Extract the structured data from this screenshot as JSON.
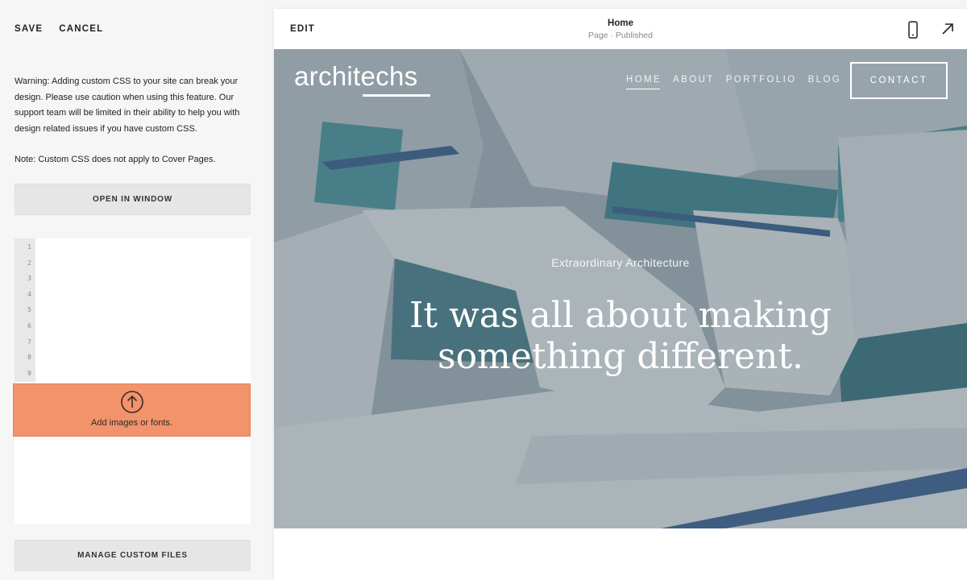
{
  "left_panel": {
    "save_label": "SAVE",
    "cancel_label": "CANCEL",
    "warning_text": "Warning: Adding custom CSS to your site can break your design. Please use caution when using this feature. Our support team will be limited in their ability to help you with design related issues if you have custom CSS.",
    "note_text": "Note: Custom CSS does not apply to Cover Pages.",
    "open_window_label": "OPEN IN WINDOW",
    "line_numbers": [
      "1",
      "2",
      "3",
      "4",
      "5",
      "6",
      "7",
      "8",
      "9"
    ],
    "upload_label": "Add images or fonts.",
    "manage_files_label": "MANAGE CUSTOM FILES",
    "upload_color": "#f2936b"
  },
  "preview": {
    "edit_label": "EDIT",
    "page_title": "Home",
    "page_status": "Page · Published",
    "icons": {
      "mobile": "phone-icon",
      "open": "external-link-icon"
    },
    "site": {
      "logo": "architechs",
      "nav": [
        "HOME",
        "ABOUT",
        "PORTFOLIO",
        "BLOG"
      ],
      "active_nav": "HOME",
      "contact_label": "CONTACT",
      "kicker": "Extraordinary Architecture",
      "headline_line1": "It was all about making",
      "headline_line2": "something different."
    }
  }
}
